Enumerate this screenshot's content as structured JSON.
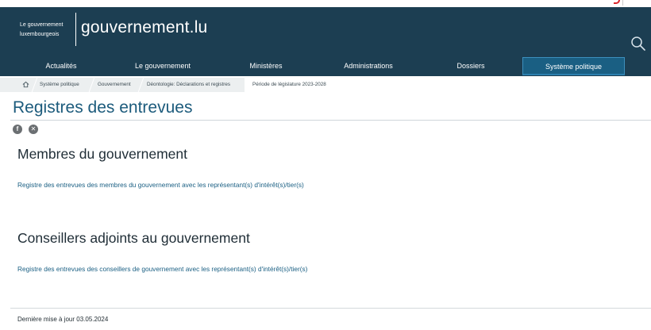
{
  "header": {
    "gov_small_line1": "Le gouvernement",
    "gov_small_line2": "luxembourgeois",
    "site_name": "gouvernement.lu"
  },
  "nav": {
    "items": [
      {
        "label": "Actualités"
      },
      {
        "label": "Le gouvernement"
      },
      {
        "label": "Ministères"
      },
      {
        "label": "Administrations"
      },
      {
        "label": "Dossiers"
      },
      {
        "label": "Système politique",
        "active": true
      }
    ]
  },
  "breadcrumb": {
    "items": [
      {
        "label": "Système politique"
      },
      {
        "label": "Gouvernement"
      },
      {
        "label": "Déontologie: Déclarations et registres"
      },
      {
        "label": "Période de législature 2023-2028"
      }
    ]
  },
  "page": {
    "title": "Registres des entrevues"
  },
  "sections": [
    {
      "title": "Membres du gouvernement",
      "link": "Registre des entrevues des membres du gouvernement avec les représentant(s) d'intérêt(s)/tier(s)"
    },
    {
      "title": "Conseillers adjoints au gouvernement",
      "link": "Registre des entrevues des conseillers de gouvernement avec les représentant(s) d'intérêt(s)/tier(s)"
    }
  ],
  "footer": {
    "updated": "Dernière mise à jour 03.05.2024"
  },
  "colors": {
    "header_bg": "#1c3e52",
    "active_tab": "#1a5f83",
    "title": "#1c5b7c",
    "link": "#1a5f83"
  },
  "icons": {
    "search": "search-icon",
    "home": "home-icon",
    "facebook": "facebook-icon",
    "x": "x-icon"
  }
}
